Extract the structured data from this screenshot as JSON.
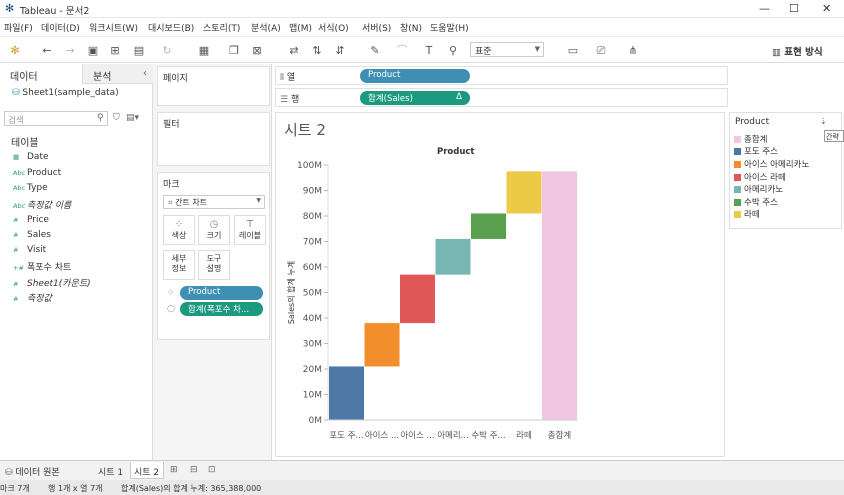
{
  "window": {
    "title": "Tableau - 문서2",
    "minimize": "—",
    "maximize": "☐",
    "close": "✕"
  },
  "menu": [
    "파일(F)",
    "데이터(D)",
    "워크시트(W)",
    "대시보드(B)",
    "스토리(T)",
    "분석(A)",
    "맵(M)",
    "서식(O)",
    "서버(S)",
    "창(N)",
    "도움말(H)"
  ],
  "toolbar": {
    "fit_combo": "표준",
    "show_me": "표현 방식"
  },
  "data_pane": {
    "tab_data": "데이터",
    "tab_analysis": "분석",
    "datasource": "Sheet1(sample_data)",
    "search_placeholder": "검색",
    "tables_header": "테이블",
    "fields": [
      {
        "icon": "▦",
        "name": "Date"
      },
      {
        "icon": "Abc",
        "name": "Product"
      },
      {
        "icon": "Abc",
        "name": "Type"
      },
      {
        "icon": "Abc",
        "name": "측정값 이름"
      },
      {
        "icon": "#",
        "name": "Price"
      },
      {
        "icon": "#",
        "name": "Sales"
      },
      {
        "icon": "#",
        "name": "Visit"
      },
      {
        "icon": "+#",
        "name": "폭포수 차트"
      },
      {
        "icon": "#",
        "name": "Sheet1(카운트)"
      },
      {
        "icon": "#",
        "name": "측정값"
      }
    ]
  },
  "cards": {
    "pages": "페이지",
    "filters": "필터",
    "marks": "마크",
    "mark_type": "간트 차트",
    "mark_buttons": [
      {
        "icon": "⁘",
        "label": "색상"
      },
      {
        "icon": "◷",
        "label": "크기"
      },
      {
        "icon": "T",
        "label": "레이블"
      },
      {
        "icon": "",
        "label": "세부\n정보"
      },
      {
        "icon": "",
        "label": "도구\n설명"
      }
    ],
    "mark_pills": [
      "Product",
      "합계(폭포수 차..."
    ]
  },
  "shelves": {
    "columns_label": "열",
    "columns_pill": "Product",
    "rows_label": "행",
    "rows_pill": "합계(Sales)",
    "rows_pill_delta": "Δ"
  },
  "view": {
    "sheet_title": "시트 2"
  },
  "legend": {
    "title": "Product",
    "tooltip_stub": "간략"
  },
  "chart_data": {
    "type": "bar",
    "title": "Product",
    "ylabel": "Sales의 합계 누계",
    "xlabel": "",
    "ylim": [
      0,
      100000000
    ],
    "yticks": [
      "0M",
      "10M",
      "20M",
      "30M",
      "40M",
      "50M",
      "60M",
      "70M",
      "80M",
      "90M",
      "100M"
    ],
    "categories": [
      "포도 주...",
      "아이스 ...",
      "아이스 ...",
      "아메리...",
      "수박 주...",
      "라떼",
      "총합계"
    ],
    "series": [
      {
        "name": "포도 주스",
        "color": "#4e79a7",
        "start": 0,
        "end": 21000000
      },
      {
        "name": "아이스 아메리카노",
        "color": "#f28e2b",
        "start": 21000000,
        "end": 38000000
      },
      {
        "name": "아이스 라떼",
        "color": "#e15759",
        "start": 38000000,
        "end": 57000000
      },
      {
        "name": "아메리카노",
        "color": "#76b7b2",
        "start": 57000000,
        "end": 71000000
      },
      {
        "name": "수박 주스",
        "color": "#59a14f",
        "start": 71000000,
        "end": 81000000
      },
      {
        "name": "라떼",
        "color": "#edc948",
        "start": 81000000,
        "end": 97500000
      },
      {
        "name": "총합계",
        "color": "#f1c6e2",
        "start": 0,
        "end": 97500000
      }
    ],
    "grid": false,
    "legend_position": "right"
  },
  "bottom_tabs": {
    "datasource": "데이터 원본",
    "sheet1": "시트 1",
    "sheet2": "시트 2"
  },
  "status": {
    "marks": "마크 7개",
    "rowscols": "행 1개 x 열 7개",
    "sum": "합계(Sales)의 합계 누계: 365,388,000"
  }
}
